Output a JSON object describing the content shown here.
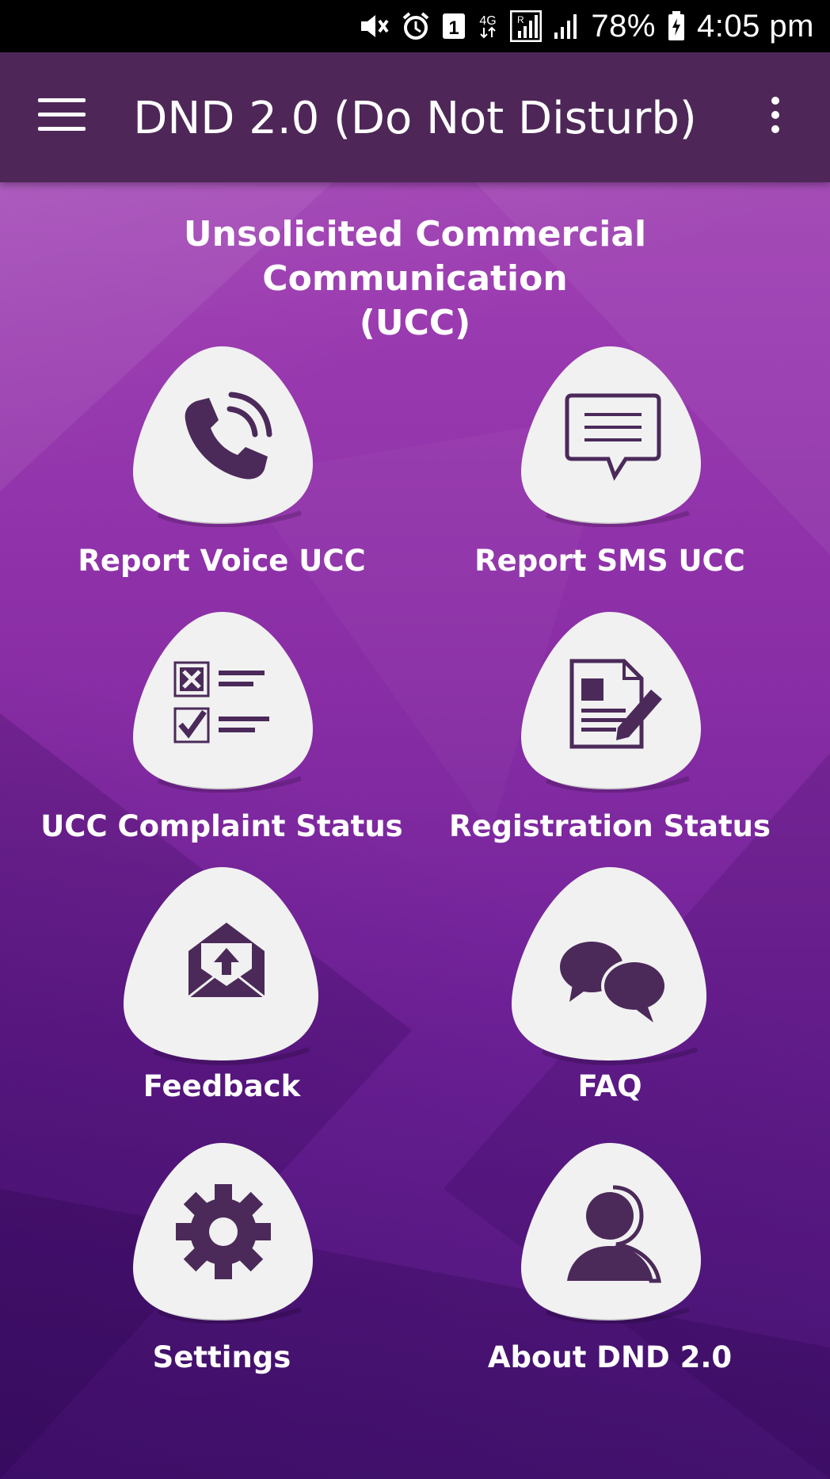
{
  "status_bar": {
    "icons": [
      "mute-icon",
      "alarm-icon",
      "sim-icon",
      "4g-icon",
      "roaming-signal-icon",
      "signal-icon",
      "battery-icon"
    ],
    "battery": "78%",
    "time": "4:05 pm"
  },
  "app_bar": {
    "title": "DND 2.0 (Do Not Disturb)",
    "menu_icon": "hamburger-menu-icon",
    "overflow_icon": "more-vertical-icon"
  },
  "heading": {
    "line1": "Unsolicited Commercial Communication",
    "line2": "(UCC)"
  },
  "tiles": [
    {
      "label": "Report Voice UCC",
      "icon": "phone-call-icon"
    },
    {
      "label": "Report SMS UCC",
      "icon": "sms-message-icon"
    },
    {
      "label": "UCC Complaint Status",
      "icon": "checklist-icon"
    },
    {
      "label": "Registration Status",
      "icon": "document-edit-icon"
    },
    {
      "label": "Feedback",
      "icon": "mail-upload-icon"
    },
    {
      "label": "FAQ",
      "icon": "chat-bubbles-icon"
    },
    {
      "label": "Settings",
      "icon": "gear-icon"
    },
    {
      "label": "About DND 2.0",
      "icon": "user-group-icon"
    }
  ],
  "colors": {
    "app_bar": "#4e2758",
    "icon_purple": "#4b2a5a",
    "background_top": "#a94fb8",
    "background_bottom": "#561b86",
    "blob": "#f1f1f1"
  }
}
